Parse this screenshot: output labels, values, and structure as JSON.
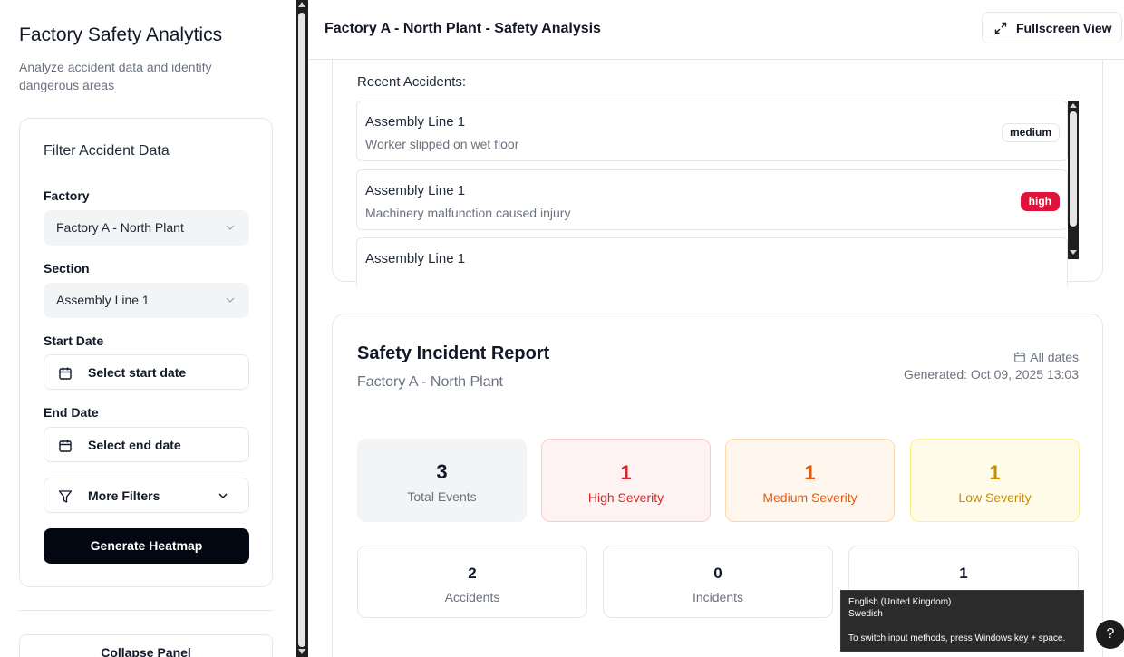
{
  "sidebar": {
    "title": "Factory Safety Analytics",
    "subtitle": "Analyze accident data and identify dangerous areas",
    "filter": {
      "title": "Filter Accident Data",
      "factory_label": "Factory",
      "factory_value": "Factory A - North Plant",
      "section_label": "Section",
      "section_value": "Assembly Line 1",
      "start_label": "Start Date",
      "start_placeholder": "Select start date",
      "end_label": "End Date",
      "end_placeholder": "Select end date",
      "more_filters": "More Filters",
      "generate": "Generate Heatmap"
    },
    "collapse": "Collapse Panel"
  },
  "main": {
    "title": "Factory A - North Plant - Safety Analysis",
    "fullscreen": "Fullscreen View",
    "recent": {
      "heading": "Recent Accidents:",
      "items": [
        {
          "section": "Assembly Line 1",
          "description": "Worker slipped on wet floor",
          "severity": "medium"
        },
        {
          "section": "Assembly Line 1",
          "description": "Machinery malfunction caused injury",
          "severity": "high"
        },
        {
          "section": "Assembly Line 1",
          "description": "",
          "severity": ""
        }
      ]
    },
    "report": {
      "title": "Safety Incident Report",
      "subtitle": "Factory A - North Plant",
      "dates": "All dates",
      "generated": "Generated: Oct 09, 2025 13:03",
      "stats": [
        {
          "value": "3",
          "label": "Total Events"
        },
        {
          "value": "1",
          "label": "High Severity"
        },
        {
          "value": "1",
          "label": "Medium Severity"
        },
        {
          "value": "1",
          "label": "Low Severity"
        }
      ],
      "types": [
        {
          "value": "2",
          "label": "Accidents"
        },
        {
          "value": "0",
          "label": "Incidents"
        },
        {
          "value": "1",
          "label": ""
        }
      ]
    }
  },
  "overlay": {
    "lang1": "English (United Kingdom)",
    "lang2": "Swedish",
    "hint": "To switch input methods, press Windows key + space.",
    "help": "?"
  },
  "colors": {
    "high": "#dc143c",
    "primary_button": "#030712",
    "high_text": "#dc2626",
    "medium_text": "#ea580c",
    "low_text": "#ca8a04"
  }
}
